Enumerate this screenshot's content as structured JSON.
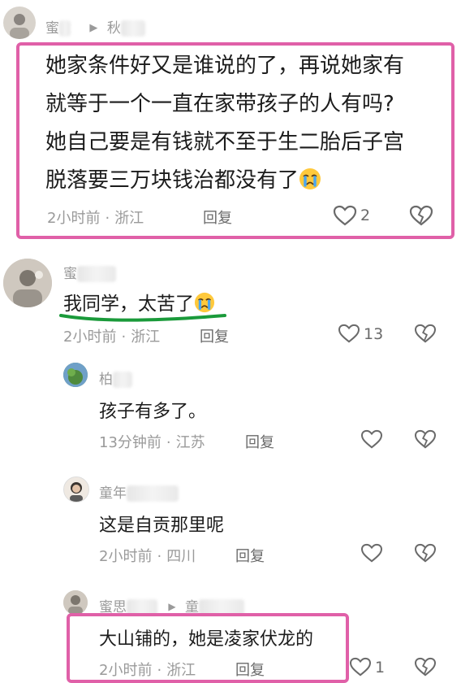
{
  "comments": [
    {
      "user": "蜜",
      "reply_to": "秋",
      "text_lines": [
        "她家条件好又是谁说的了，再说她家有",
        "就等于一个一直在家带孩子的人有吗?",
        "她自己要是有钱就不至于生二胎后子宫",
        "脱落要三万块钱治都没有了"
      ],
      "time": "2小时前",
      "location": "浙江",
      "reply_label": "回复",
      "likes": "2"
    },
    {
      "user": "蜜",
      "text": "我同学，太苦了",
      "time": "2小时前",
      "location": "浙江",
      "reply_label": "回复",
      "likes": "13"
    }
  ],
  "replies": [
    {
      "user": "柏",
      "text": "孩子有多了。",
      "time": "13分钟前",
      "location": "江苏",
      "reply_label": "回复"
    },
    {
      "user": "童年",
      "text": "这是自贡那里呢",
      "time": "2小时前",
      "location": "四川",
      "reply_label": "回复"
    },
    {
      "user": "蜜思",
      "reply_to": "童",
      "text": "大山铺的，她是凌家伏龙的",
      "time": "2小时前",
      "location": "浙江",
      "reply_label": "回复",
      "likes": "1"
    }
  ],
  "icons": {
    "like": "heart-outline-icon",
    "dislike": "broken-heart-icon",
    "reply_arrow": "play-triangle-icon",
    "emoji": "crying-face-emoji"
  },
  "colors": {
    "highlight_box": "#e060a8",
    "underline": "#1a9a3a",
    "meta_text": "#9a9a9a"
  }
}
